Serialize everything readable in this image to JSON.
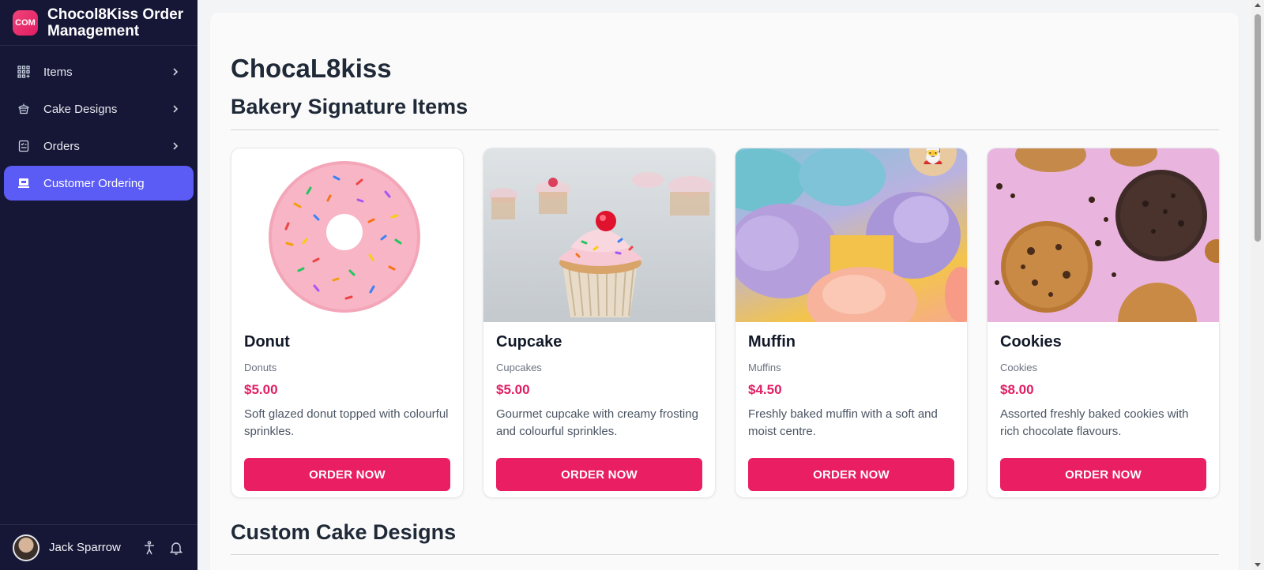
{
  "app": {
    "logo_text": "COM",
    "title": "Chocol8Kiss Order Management"
  },
  "sidebar": {
    "items": [
      {
        "label": "Items",
        "icon": "grid-icon"
      },
      {
        "label": "Cake Designs",
        "icon": "cake-icon"
      },
      {
        "label": "Orders",
        "icon": "clipboard-icon"
      },
      {
        "label": "Customer Ordering",
        "icon": "storefront-icon"
      }
    ],
    "user": {
      "name": "Jack Sparrow"
    }
  },
  "main": {
    "page_title": "ChocaL8kiss",
    "sections": [
      {
        "title": "Bakery Signature Items"
      },
      {
        "title": "Custom Cake Designs"
      }
    ],
    "products": [
      {
        "name": "Donut",
        "category": "Donuts",
        "price": "$5.00",
        "description": "Soft glazed donut topped with colourful sprinkles.",
        "button": "ORDER NOW"
      },
      {
        "name": "Cupcake",
        "category": "Cupcakes",
        "price": "$5.00",
        "description": "Gourmet cupcake with creamy frosting and colourful sprinkles.",
        "button": "ORDER NOW"
      },
      {
        "name": "Muffin",
        "category": "Muffins",
        "price": "$4.50",
        "description": "Freshly baked muffin with a soft and moist centre.",
        "button": "ORDER NOW"
      },
      {
        "name": "Cookies",
        "category": "Cookies",
        "price": "$8.00",
        "description": "Assorted freshly baked cookies with rich chocolate flavours.",
        "button": "ORDER NOW"
      }
    ]
  },
  "colors": {
    "sidebar_bg": "#161637",
    "active_nav": "#5b5bf6",
    "accent": "#e91e63",
    "price": "#e11d62"
  }
}
